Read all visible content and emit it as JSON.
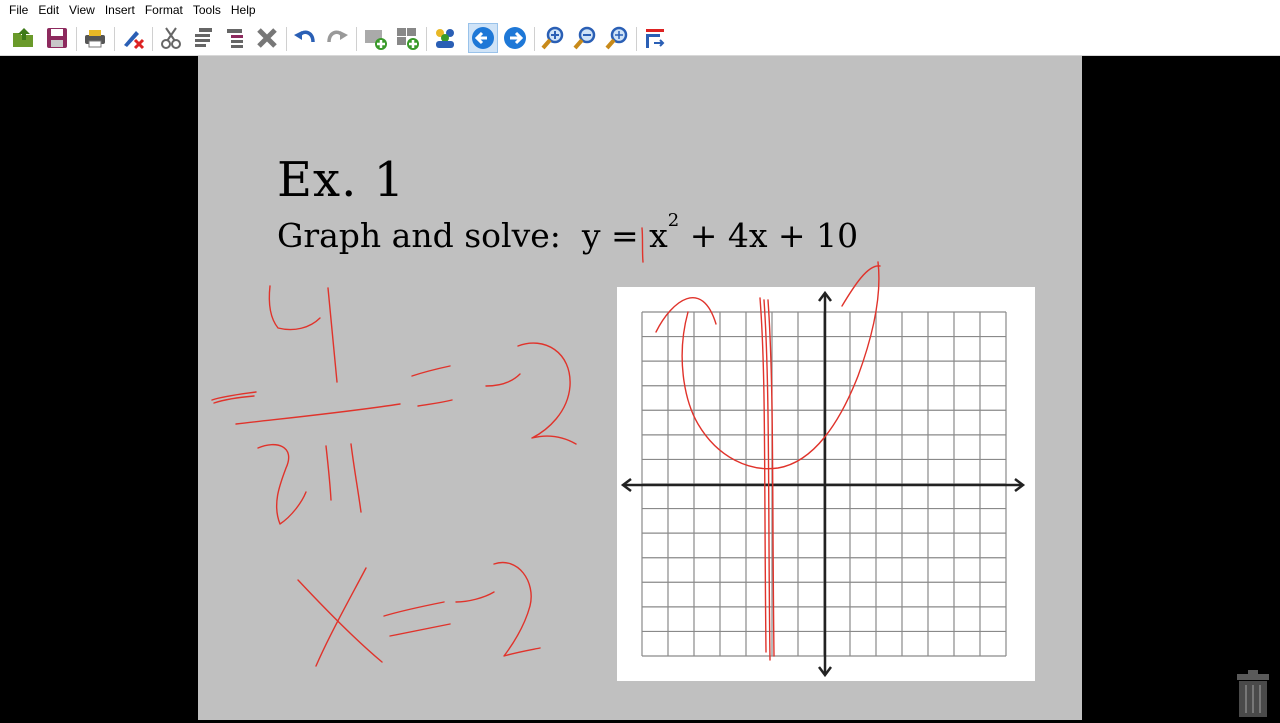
{
  "menubar": {
    "items": [
      "File",
      "Edit",
      "View",
      "Insert",
      "Format",
      "Tools",
      "Help"
    ]
  },
  "toolbar": {
    "buttons": [
      {
        "name": "open-button",
        "icon": "folder-open-icon"
      },
      {
        "name": "save-button",
        "icon": "floppy-disk-icon"
      },
      {
        "name": "print-button",
        "icon": "printer-icon"
      },
      {
        "name": "clear-ink-button",
        "icon": "pen-x-icon"
      },
      {
        "name": "cut-button",
        "icon": "scissors-icon"
      },
      {
        "name": "copy-button",
        "icon": "copy-pages-icon"
      },
      {
        "name": "paste-button",
        "icon": "clipboard-icon"
      },
      {
        "name": "delete-button",
        "icon": "x-delete-icon"
      },
      {
        "name": "undo-button",
        "icon": "undo-arrow-icon"
      },
      {
        "name": "redo-button",
        "icon": "redo-arrow-icon"
      },
      {
        "name": "new-page-button",
        "icon": "page-plus-icon"
      },
      {
        "name": "duplicate-page-button",
        "icon": "pages-plus-icon"
      },
      {
        "name": "users-button",
        "icon": "people-icon"
      },
      {
        "name": "previous-page-button",
        "icon": "arrow-left-circle-icon"
      },
      {
        "name": "next-page-button",
        "icon": "arrow-right-circle-icon"
      },
      {
        "name": "zoom-in-button",
        "icon": "magnifier-plus-icon"
      },
      {
        "name": "zoom-out-button",
        "icon": "magnifier-minus-icon"
      },
      {
        "name": "zoom-fit-button",
        "icon": "magnifier-fit-icon"
      },
      {
        "name": "fit-width-button",
        "icon": "fit-width-icon"
      }
    ],
    "active_button": "previous-page-button"
  },
  "slide": {
    "title": "Ex. 1",
    "problem_prefix": "Graph and solve:  y = ",
    "problem_var": "x",
    "problem_exp": "2",
    "problem_suffix": " + 4x + 10"
  },
  "colors": {
    "ink": "#e0332b",
    "slide_bg": "#c0c0c0",
    "active_button_bg": "#cfe3f7",
    "nav_blue": "#1e78d7"
  }
}
